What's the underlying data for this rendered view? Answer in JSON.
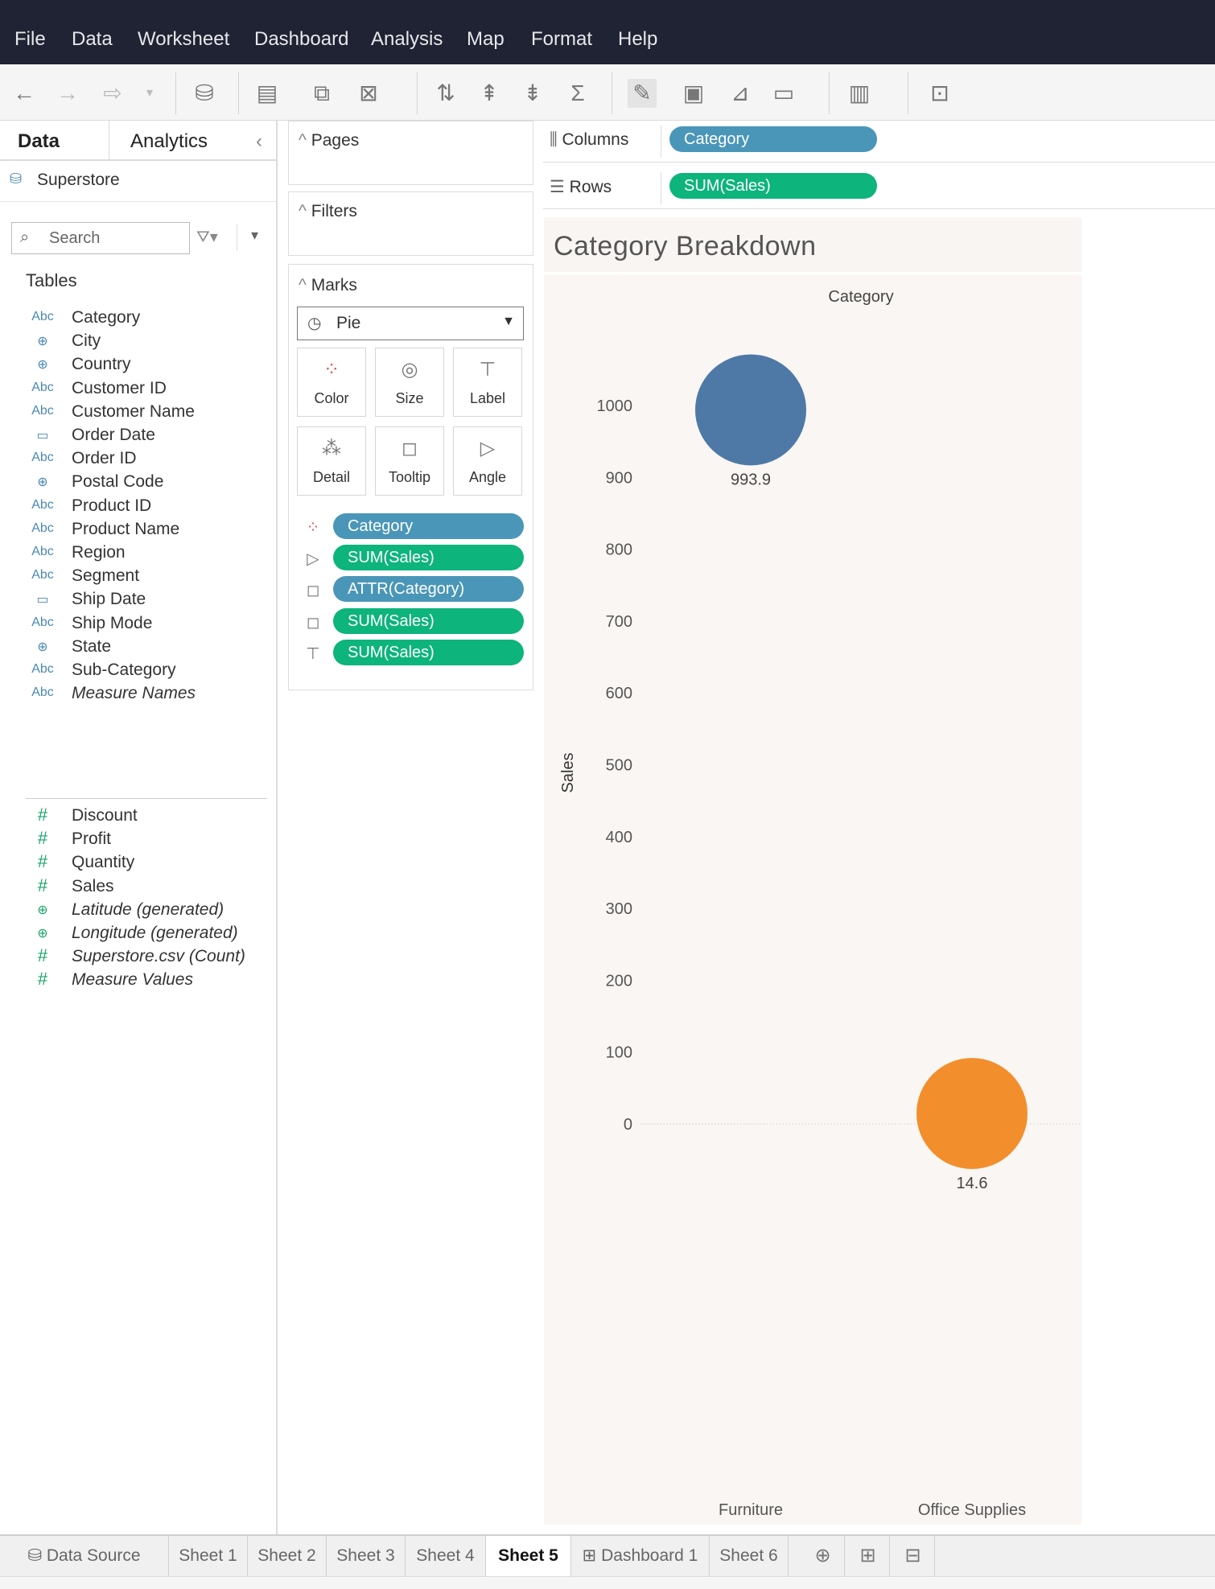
{
  "menu": [
    "File",
    "Data",
    "Worksheet",
    "Dashboard",
    "Analysis",
    "Map",
    "Format",
    "Help"
  ],
  "data_pane": {
    "tab_data": "Data",
    "tab_analytics": "Analytics",
    "collapse_glyph": "‹",
    "datasource": "Superstore",
    "search_placeholder": "Search",
    "tables_heading": "Tables",
    "dimensions": [
      {
        "name": "Category",
        "type": "Abc"
      },
      {
        "name": "City",
        "type": "globe"
      },
      {
        "name": "Country",
        "type": "globe"
      },
      {
        "name": "Customer ID",
        "type": "Abc"
      },
      {
        "name": "Customer Name",
        "type": "Abc"
      },
      {
        "name": "Order Date",
        "type": "calendar"
      },
      {
        "name": "Order ID",
        "type": "Abc"
      },
      {
        "name": "Postal Code",
        "type": "globe"
      },
      {
        "name": "Product ID",
        "type": "Abc"
      },
      {
        "name": "Product Name",
        "type": "Abc"
      },
      {
        "name": "Region",
        "type": "Abc"
      },
      {
        "name": "Segment",
        "type": "Abc"
      },
      {
        "name": "Ship Date",
        "type": "calendar"
      },
      {
        "name": "Ship Mode",
        "type": "Abc"
      },
      {
        "name": "State",
        "type": "globe"
      },
      {
        "name": "Sub-Category",
        "type": "Abc"
      },
      {
        "name": "Measure Names",
        "type": "Abc",
        "generated": true
      }
    ],
    "measures": [
      {
        "name": "Discount",
        "type": "#"
      },
      {
        "name": "Profit",
        "type": "#"
      },
      {
        "name": "Quantity",
        "type": "#"
      },
      {
        "name": "Sales",
        "type": "#"
      },
      {
        "name": "Latitude (generated)",
        "type": "globe",
        "generated": true
      },
      {
        "name": "Longitude (generated)",
        "type": "globe",
        "generated": true
      },
      {
        "name": "Superstore.csv (Count)",
        "type": "#",
        "generated": true
      },
      {
        "name": "Measure Values",
        "type": "#",
        "generated": true
      }
    ]
  },
  "cards": {
    "pages": "Pages",
    "filters": "Filters",
    "marks": "Marks",
    "mark_type": "Pie",
    "mark_buttons": [
      "Color",
      "Size",
      "Label",
      "Detail",
      "Tooltip",
      "Angle"
    ],
    "encodings": [
      {
        "icon": "color",
        "label": "Category",
        "kind": "dim"
      },
      {
        "icon": "angle",
        "label": "SUM(Sales)",
        "kind": "mea"
      },
      {
        "icon": "tooltip",
        "label": "ATTR(Category)",
        "kind": "dim"
      },
      {
        "icon": "tooltip",
        "label": "SUM(Sales)",
        "kind": "mea"
      },
      {
        "icon": "label",
        "label": "SUM(Sales)",
        "kind": "mea"
      }
    ]
  },
  "shelves": {
    "columns_label": "Columns",
    "columns_pill": "Category",
    "rows_label": "Rows",
    "rows_pill": "SUM(Sales)"
  },
  "view": {
    "title": "Category Breakdown"
  },
  "chart_data": {
    "type": "scatter",
    "mark": "pie",
    "column_header": "Category",
    "ylabel": "Sales",
    "ylim": [
      0,
      1000
    ],
    "yticks": [
      0,
      100,
      200,
      300,
      400,
      500,
      600,
      700,
      800,
      900,
      1000
    ],
    "categories": [
      "Furniture",
      "Office Supplies"
    ],
    "values": [
      993.9,
      14.6
    ],
    "value_labels": [
      "993.9",
      "14.6"
    ],
    "colors": [
      "#4e79a7",
      "#f28e2b"
    ]
  },
  "sheet_tabs": [
    {
      "label": "Data Source",
      "icon": "datasource"
    },
    {
      "label": "Sheet 1"
    },
    {
      "label": "Sheet 2"
    },
    {
      "label": "Sheet 3"
    },
    {
      "label": "Sheet 4"
    },
    {
      "label": "Sheet 5",
      "active": true
    },
    {
      "label": "Dashboard 1",
      "icon": "dashboard"
    },
    {
      "label": "Sheet 6"
    }
  ]
}
